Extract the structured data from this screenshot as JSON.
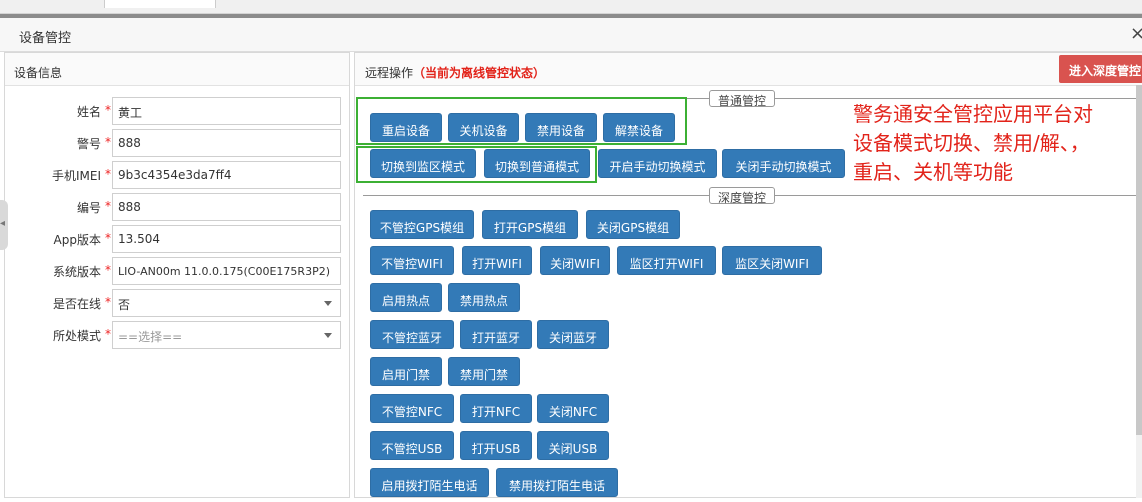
{
  "dialog": {
    "title": "设备管控",
    "close_glyph": "×"
  },
  "left_panel": {
    "title": "设备信息",
    "fields": [
      {
        "label": "姓名",
        "value": "黄工"
      },
      {
        "label": "警号",
        "value": "888"
      },
      {
        "label": "手机IMEI",
        "value": "9b3c4354e3da7ff4"
      },
      {
        "label": "编号",
        "value": "888"
      },
      {
        "label": "App版本",
        "value": "13.504"
      },
      {
        "label": "系统版本",
        "value": "LIO-AN00m 11.0.0.175(C00E175R3P2)"
      },
      {
        "label": "是否在线",
        "value": "否"
      },
      {
        "label": "所处模式",
        "value": "==选择=="
      }
    ],
    "required_mark": "*"
  },
  "right_panel": {
    "title": "远程操作",
    "status": "（当前为离线管控状态）",
    "deep_control_button": "进入深度管控",
    "normal_section_label": "普通管控",
    "deep_section_label": "深度管控",
    "normal_row1": [
      "重启设备",
      "关机设备",
      "禁用设备",
      "解禁设备"
    ],
    "normal_row2": [
      "切换到监区模式",
      "切换到普通模式",
      "开启手动切换模式",
      "关闭手动切换模式"
    ],
    "deep_rows": [
      [
        "不管控GPS模组",
        "打开GPS模组",
        "关闭GPS模组"
      ],
      [
        "不管控WIFI",
        "打开WIFI",
        "关闭WIFI",
        "监区打开WIFI",
        "监区关闭WIFI"
      ],
      [
        "启用热点",
        "禁用热点"
      ],
      [
        "不管控蓝牙",
        "打开蓝牙",
        "关闭蓝牙"
      ],
      [
        "启用门禁",
        "禁用门禁"
      ],
      [
        "不管控NFC",
        "打开NFC",
        "关闭NFC"
      ],
      [
        "不管控USB",
        "打开USB",
        "关闭USB"
      ],
      [
        "启用拨打陌生电话",
        "禁用拨打陌生电话"
      ]
    ]
  },
  "annotation": {
    "lines": [
      "警务通安全管控应用平台对",
      "设备模式切换、禁用/解、，",
      "重启、关机等功能"
    ]
  },
  "colors": {
    "primary": "#337ab7",
    "danger": "#d9534f",
    "highlight": "#3cb034",
    "note": "#e2231a"
  }
}
